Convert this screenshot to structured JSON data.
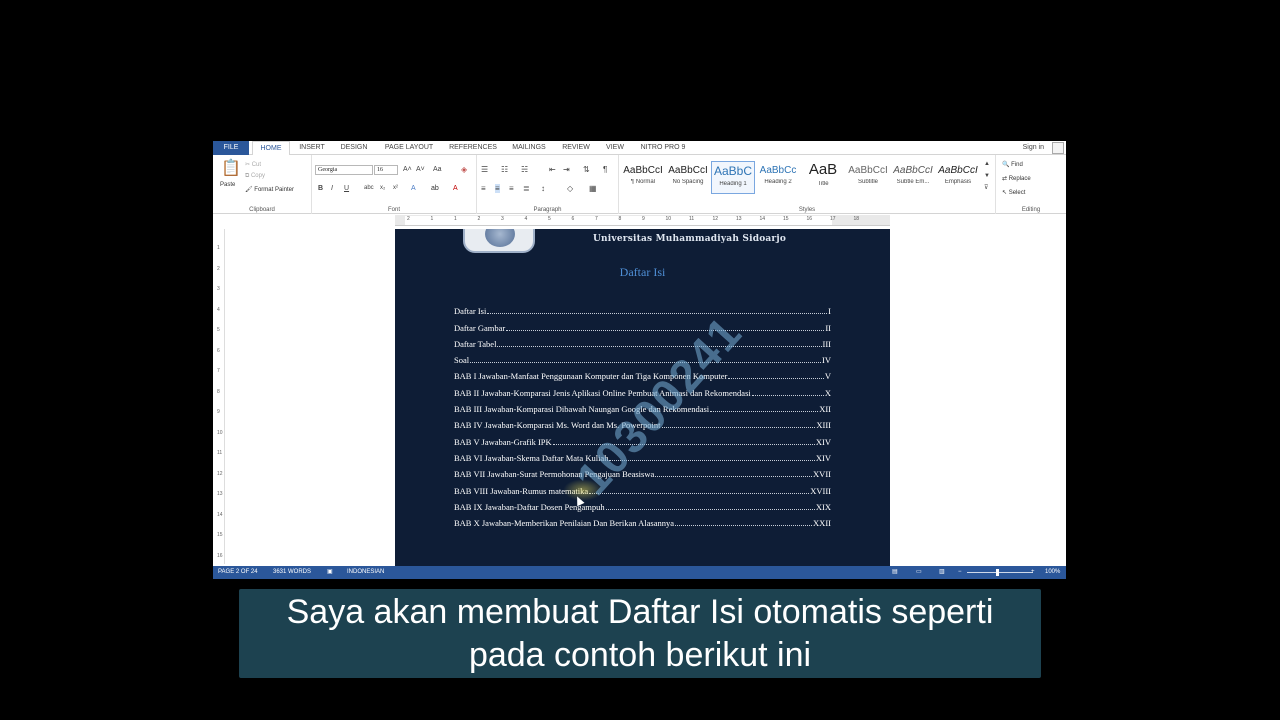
{
  "ribbon_tabs": [
    "FILE",
    "HOME",
    "INSERT",
    "DESIGN",
    "PAGE LAYOUT",
    "REFERENCES",
    "MAILINGS",
    "REVIEW",
    "VIEW",
    "NITRO PRO 9"
  ],
  "sign_in": "Sign in",
  "clipboard": {
    "paste": "Paste",
    "cut": "Cut",
    "copy": "Copy",
    "format_painter": "Format Painter",
    "label": "Clipboard"
  },
  "font": {
    "family": "Georgia",
    "size": "16",
    "label": "Font"
  },
  "paragraph": {
    "label": "Paragraph"
  },
  "styles": {
    "label": "Styles",
    "items": [
      {
        "sample": "AaBbCcI",
        "name": "¶ Normal"
      },
      {
        "sample": "AaBbCcI",
        "name": "No Spacing"
      },
      {
        "sample": "AaBbC",
        "name": "Heading 1"
      },
      {
        "sample": "AaBbCc",
        "name": "Heading 2"
      },
      {
        "sample": "AaB",
        "name": "Title"
      },
      {
        "sample": "AaBbCcI",
        "name": "Subtitle"
      },
      {
        "sample": "AaBbCcI",
        "name": "Subtle Em..."
      },
      {
        "sample": "AaBbCcI",
        "name": "Emphasis"
      }
    ]
  },
  "editing": {
    "find": "Find",
    "replace": "Replace",
    "select": "Select",
    "label": "Editing"
  },
  "ruler_numbers": [
    "2",
    "1",
    "1",
    "2",
    "3",
    "4",
    "5",
    "6",
    "7",
    "8",
    "9",
    "10",
    "11",
    "12",
    "13",
    "14",
    "15",
    "16",
    "17",
    "18"
  ],
  "vruler_numbers": [
    "1",
    "2",
    "3",
    "4",
    "5",
    "6",
    "7",
    "8",
    "9",
    "10",
    "11",
    "12",
    "13",
    "14",
    "15",
    "16"
  ],
  "document": {
    "header": "Universitas Muhammadiyah Sidoarjo",
    "title": "Daftar Isi",
    "watermark": "10300241",
    "toc": [
      {
        "text": "Daftar Isi",
        "page": "I"
      },
      {
        "text": "Daftar Gambar",
        "page": "II"
      },
      {
        "text": "Daftar Tabel",
        "page": "III"
      },
      {
        "text": "Soal",
        "page": "IV"
      },
      {
        "text": "BAB I Jawaban-Manfaat Penggunaan Komputer dan Tiga Komponen Komputer",
        "page": "V"
      },
      {
        "text": "BAB II Jawaban-Komparasi Jenis Aplikasi Online Pembuat Animasi dan Rekomendasi",
        "page": "X"
      },
      {
        "text": "BAB III Jawaban-Komparasi Dibawah Naungan Google dan Rekomendasi",
        "page": "XII"
      },
      {
        "text": "BAB IV Jawaban-Komparasi Ms. Word dan Ms. Powerpoint",
        "page": "XIII"
      },
      {
        "text": "BAB V Jawaban-Grafik IPK",
        "page": "XIV"
      },
      {
        "text": "BAB VI Jawaban-Skema Daftar  Mata Kuliah",
        "page": "XIV"
      },
      {
        "text": "BAB VII Jawaban-Surat Permohonan Pengajuan Beasiswa",
        "page": "XVII"
      },
      {
        "text": "BAB VIII Jawaban-Rumus matematika",
        "page": "XVIII"
      },
      {
        "text": "BAB IX Jawaban-Daftar Dosen Pengampuh",
        "page": "XIX"
      },
      {
        "text": "BAB X Jawaban-Memberikan Penilaian Dan Berikan Alasannya",
        "page": "XXII"
      }
    ]
  },
  "statusbar": {
    "page": "PAGE 2 OF 24",
    "words": "3631 WORDS",
    "language": "INDONESIAN",
    "zoom": "100%"
  },
  "caption": "Saya akan membuat Daftar Isi otomatis seperti\npada contoh berikut ini"
}
